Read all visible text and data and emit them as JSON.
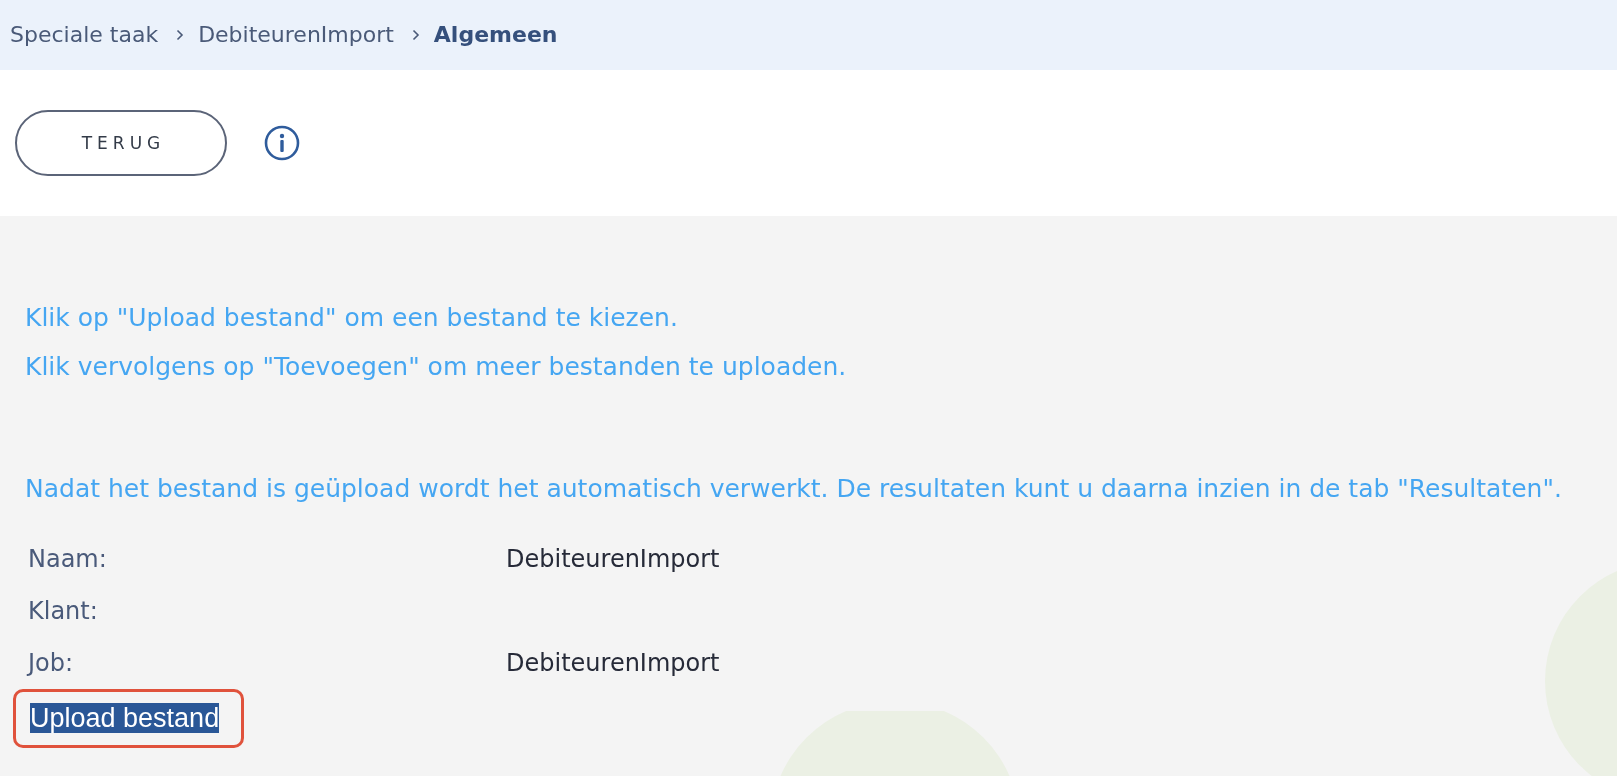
{
  "breadcrumb": [
    {
      "label": "Speciale taak",
      "current": false
    },
    {
      "label": "DebiteurenImport",
      "current": false
    },
    {
      "label": "Algemeen",
      "current": true
    }
  ],
  "toolbar": {
    "back_button": "TERUG"
  },
  "instructions": [
    [
      "Klik op \"Upload bestand\" om een bestand te kiezen.",
      "Klik vervolgens op \"Toevoegen\" om meer bestanden te uploaden."
    ],
    [
      "Nadat het bestand is geüpload wordt het automatisch verwerkt. De resultaten kunt u daarna inzien in de tab \"Resultaten\"."
    ]
  ],
  "fields": [
    {
      "label": "Naam:",
      "value": "DebiteurenImport"
    },
    {
      "label": "Klant:"
    },
    {
      "label": "Job:",
      "value": "DebiteurenImport"
    }
  ],
  "upload_link": {
    "label": "Upload bestand",
    "selected": true,
    "highlighted": true
  }
}
